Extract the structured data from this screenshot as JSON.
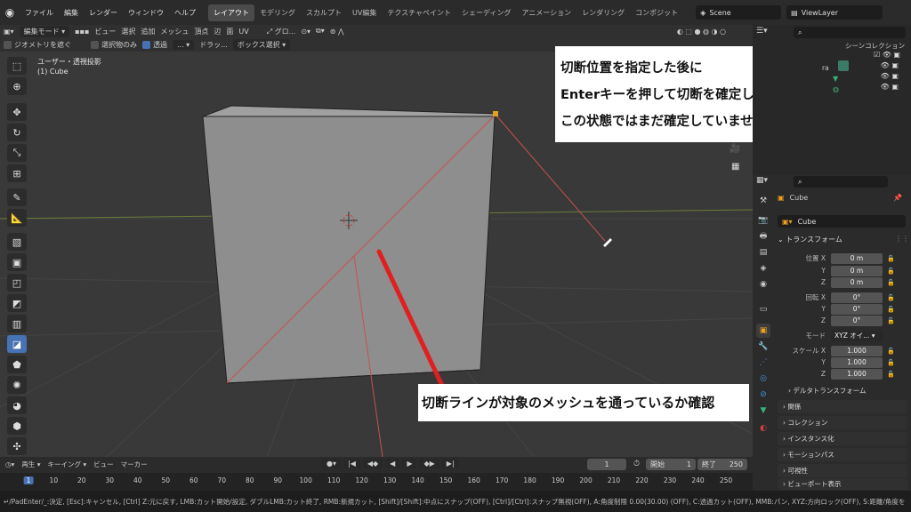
{
  "topbar": {
    "menus": [
      "ファイル",
      "編集",
      "レンダー",
      "ウィンドウ",
      "ヘルプ"
    ],
    "workspaces": [
      "レイアウト",
      "モデリング",
      "スカルプト",
      "UV編集",
      "テクスチャペイント",
      "シェーディング",
      "アニメーション",
      "レンダリング",
      "コンポジット"
    ],
    "active_workspace": "レイアウト",
    "scene": "Scene",
    "view_layer": "ViewLayer"
  },
  "header1": {
    "mode": "編集モード",
    "menus": [
      "ビュー",
      "選択",
      "追加",
      "メッシュ",
      "頂点",
      "辺",
      "面",
      "UV"
    ],
    "orientation": "グロ..."
  },
  "header2": {
    "occlude_geometry": "ジオメトリを遮ぐ",
    "selected_only": "選択物のみ",
    "xray": "透過",
    "drag": "ドラッ...",
    "box_select": "ボックス選択"
  },
  "viewport": {
    "view_name": "ユーザー・透視投影",
    "object_name": "(1) Cube"
  },
  "callouts": {
    "top_lines": [
      "切断位置を指定した後に",
      "Enterキーを押して切断を確定します",
      "この状態ではまだ確定していません"
    ],
    "bottom": "切断ラインが対象のメッシュを通っているか確認"
  },
  "outliner": {
    "title": "シーンコレクション",
    "partial_label": "ra"
  },
  "properties": {
    "object": "Cube",
    "object_field": "Cube",
    "transform_title": "トランスフォーム",
    "location_label": "位置",
    "rotation_label": "回転",
    "scale_label": "スケール",
    "mode_label": "モード",
    "mode_value": "XYZ オイ...",
    "axes": [
      "X",
      "Y",
      "Z"
    ],
    "location": [
      "0 m",
      "0 m",
      "0 m"
    ],
    "rotation": [
      "0°",
      "0°",
      "0°"
    ],
    "scale": [
      "1.000",
      "1.000",
      "1.000"
    ],
    "delta_transform": "デルタトランスフォーム",
    "panels": [
      "関係",
      "コレクション",
      "インスタンス化",
      "モーションパス",
      "可視性",
      "ビューポート表示"
    ]
  },
  "timeline": {
    "playback": "再生",
    "keying": "キーイング",
    "view": "ビュー",
    "marker": "マーカー",
    "current_frame": "1",
    "start_label": "開始",
    "start": "1",
    "end_label": "終了",
    "end": "250",
    "ticks": [
      "1",
      "10",
      "20",
      "30",
      "40",
      "50",
      "60",
      "70",
      "80",
      "90",
      "100",
      "110",
      "120",
      "130",
      "140",
      "150",
      "160",
      "170",
      "180",
      "190",
      "200",
      "210",
      "220",
      "230",
      "240",
      "250"
    ]
  },
  "statusbar": {
    "text": "↵/PadEnter/_:決定, [Esc]:キャンセル, [Ctrl] Z:元に戻す, LMB:カット開始/設定, ダブルLMB:カット終了, RMB:新規カット, [Shift]/[Shift]:中点にスナップ(OFF), [Ctrl]/[Ctrl]:スナップ無視(OFF), A:角度制限 0.00(30.00) (OFF), C:透過カット(OFF), MMB:パン, XYZ:方向ロック(OFF), S:距離/角度を"
  },
  "colors": {
    "accent": "#4772b3",
    "active_frame": "#4772b3",
    "annotation": "#e02020"
  }
}
